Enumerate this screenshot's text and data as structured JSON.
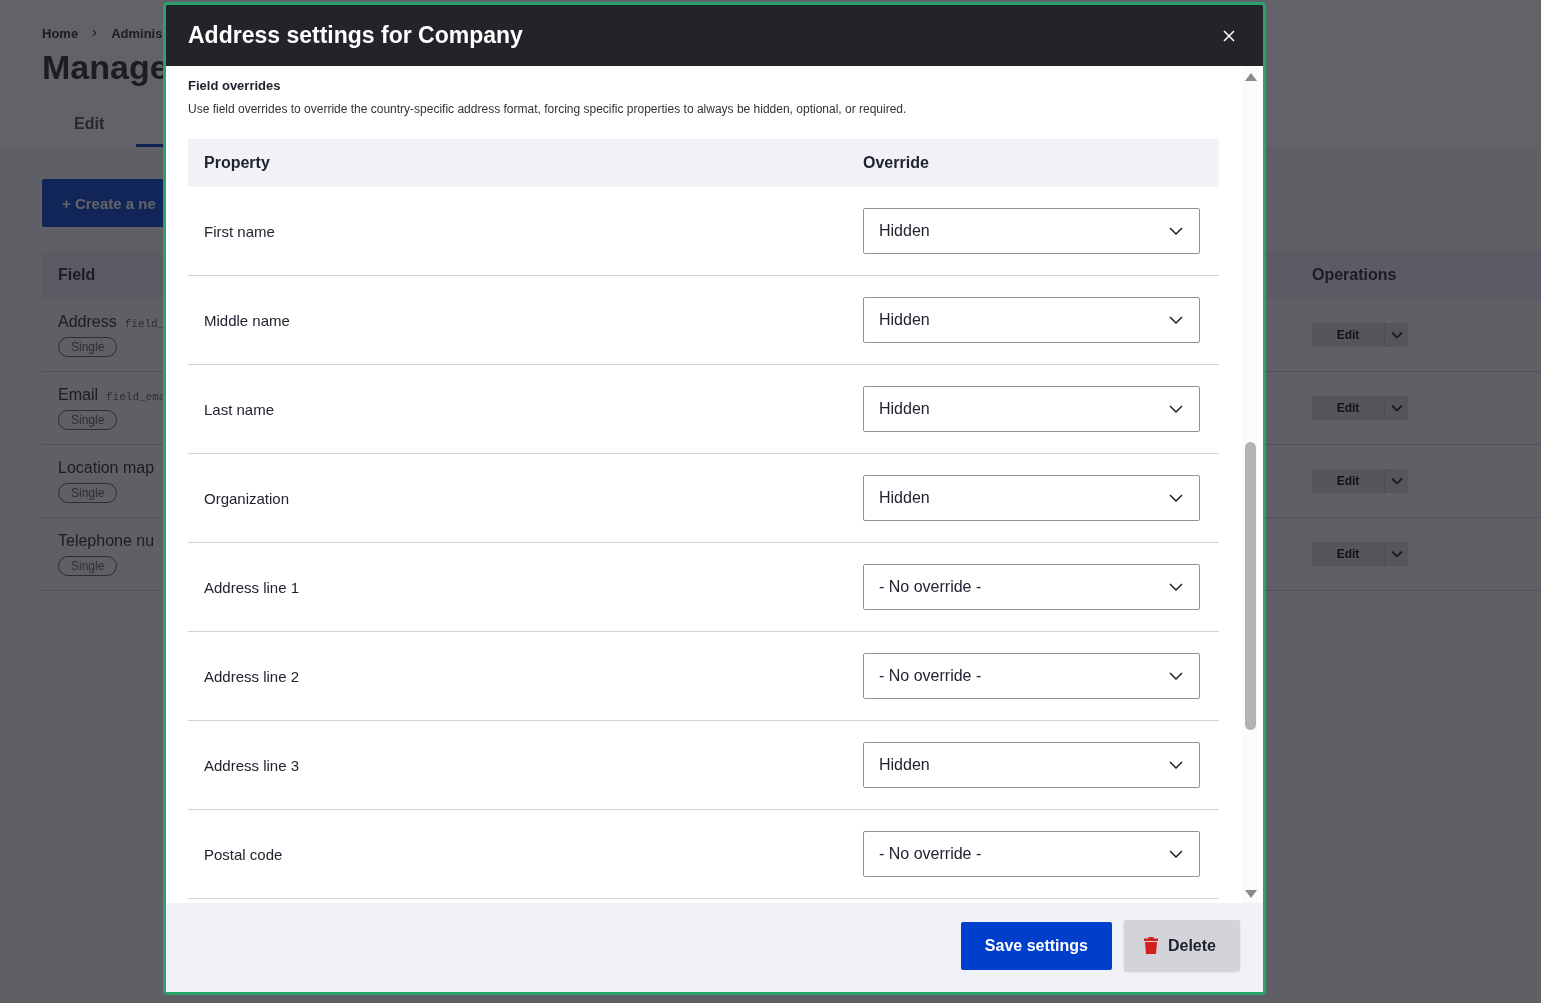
{
  "background_page": {
    "breadcrumb": [
      "Home",
      "Adminis"
    ],
    "title": "Manage",
    "tabs": [
      {
        "label": "Edit",
        "selected": false
      }
    ],
    "create_button": "+ Create a ne",
    "table": {
      "columns": [
        "Field",
        "Operations"
      ],
      "rows": [
        {
          "label": "Address",
          "machine_name": "field_",
          "badge": "Single",
          "operation": "Edit"
        },
        {
          "label": "Email",
          "machine_name": "field_ema",
          "badge": "Single",
          "operation": "Edit"
        },
        {
          "label": "Location map",
          "badge": "Single",
          "operation": "Edit"
        },
        {
          "label": "Telephone nu",
          "badge": "Single",
          "operation": "Edit"
        }
      ]
    }
  },
  "dialog": {
    "title": "Address settings for Company",
    "section_title": "Field overrides",
    "description": "Use field overrides to override the country-specific address format, forcing specific properties to always be hidden, optional, or required.",
    "columns": [
      "Property",
      "Override"
    ],
    "rows": [
      {
        "property": "First name",
        "override": "Hidden"
      },
      {
        "property": "Middle name",
        "override": "Hidden"
      },
      {
        "property": "Last name",
        "override": "Hidden"
      },
      {
        "property": "Organization",
        "override": "Hidden"
      },
      {
        "property": "Address line 1",
        "override": "- No override -"
      },
      {
        "property": "Address line 2",
        "override": "- No override -"
      },
      {
        "property": "Address line 3",
        "override": "Hidden"
      },
      {
        "property": "Postal code",
        "override": "- No override -"
      }
    ],
    "buttons": [
      {
        "label": "Save settings",
        "kind": "primary"
      },
      {
        "label": "Delete",
        "kind": "danger"
      }
    ]
  }
}
